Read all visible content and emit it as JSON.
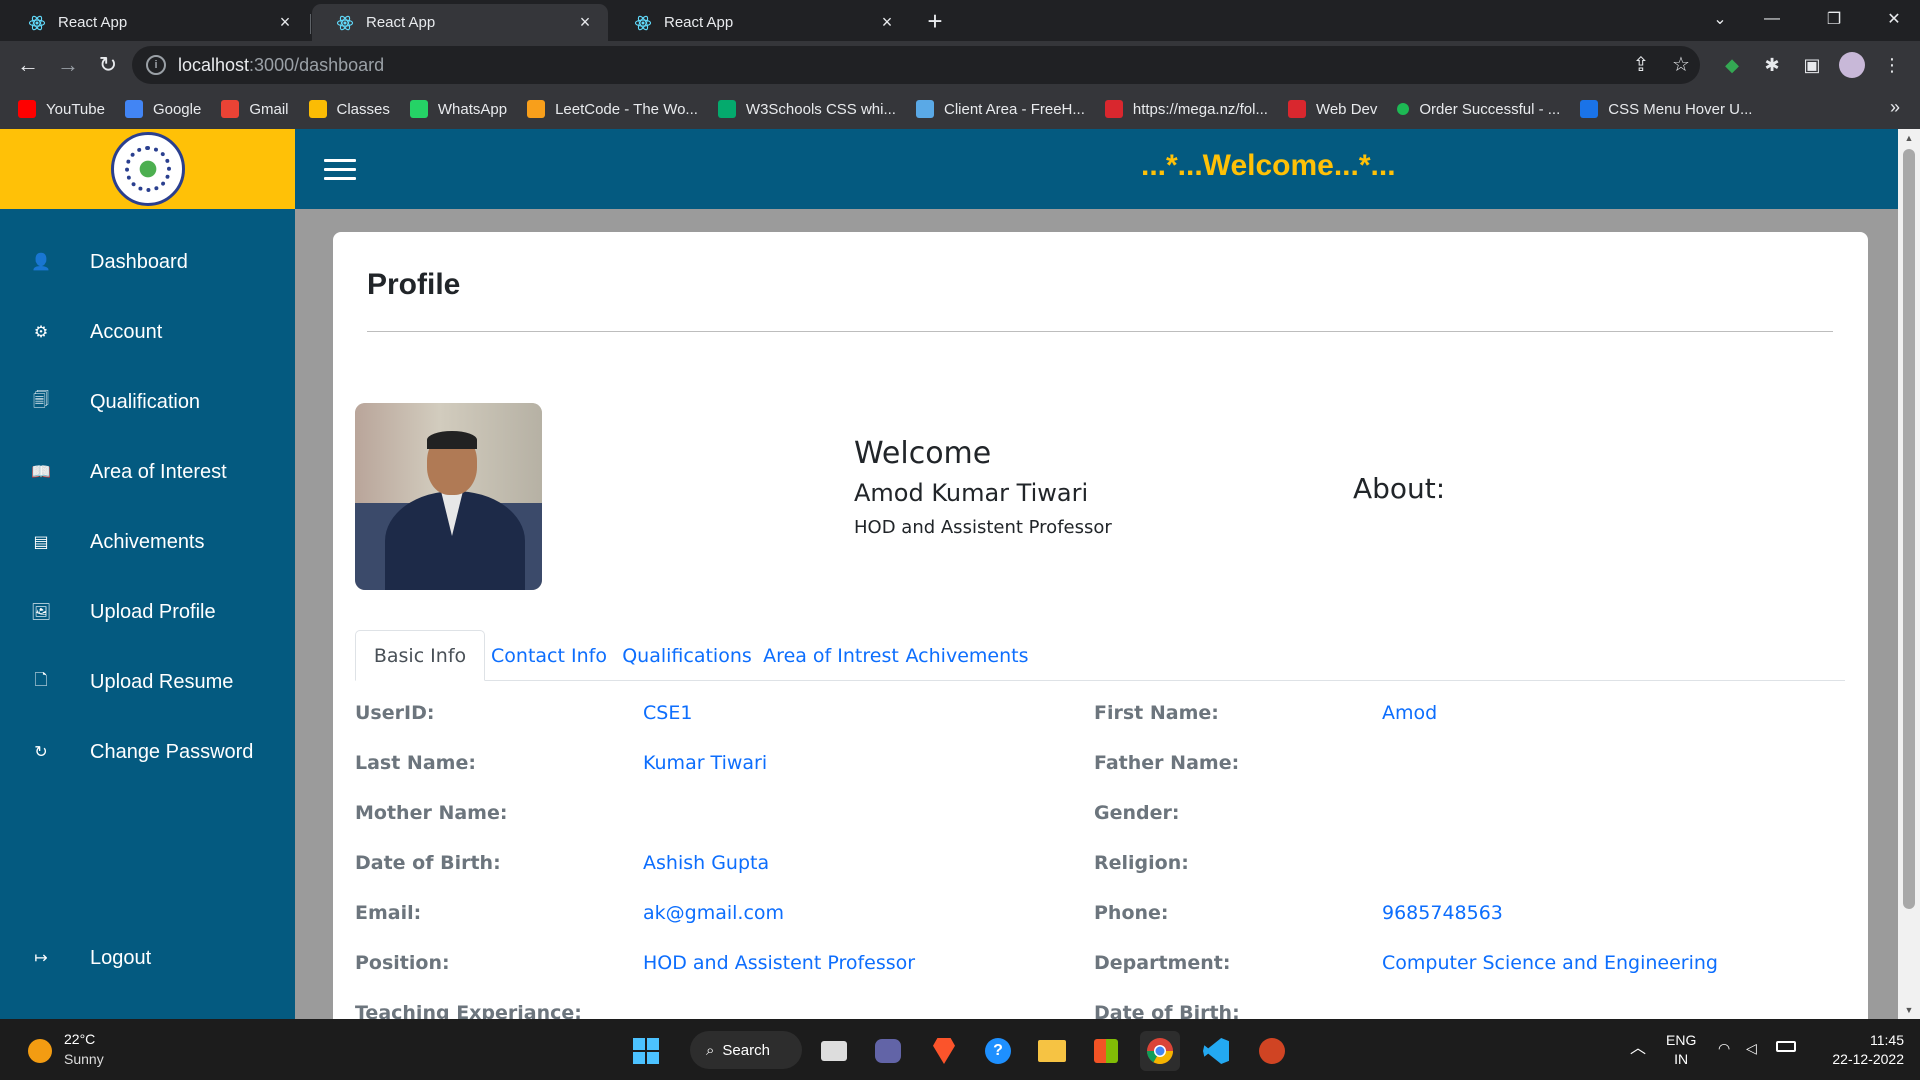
{
  "browser": {
    "tabs": [
      {
        "title": "React App"
      },
      {
        "title": "React App"
      },
      {
        "title": "React App"
      }
    ],
    "url_host": "localhost",
    "url_path": ":3000/dashboard",
    "bookmarks": [
      {
        "label": "YouTube",
        "icon": "youtube-icon",
        "color": "#ff0000"
      },
      {
        "label": "Google",
        "icon": "google-icon",
        "color": "#4285f4"
      },
      {
        "label": "Gmail",
        "icon": "gmail-icon",
        "color": "#ea4335"
      },
      {
        "label": "Classes",
        "icon": "classroom-icon",
        "color": "#fbbc04"
      },
      {
        "label": "WhatsApp",
        "icon": "whatsapp-icon",
        "color": "#25d366"
      },
      {
        "label": "LeetCode - The Wo...",
        "icon": "leetcode-icon",
        "color": "#f89f1b"
      },
      {
        "label": "W3Schools CSS whi...",
        "icon": "w3schools-icon",
        "color": "#04aa6d"
      },
      {
        "label": "Client Area - FreeH...",
        "icon": "freehosting-icon",
        "color": "#5aa9e6"
      },
      {
        "label": "https://mega.nz/fol...",
        "icon": "mega-icon",
        "color": "#d9272e"
      },
      {
        "label": "Web Dev",
        "icon": "mega-icon",
        "color": "#d9272e"
      },
      {
        "label": "Order Successful - ...",
        "icon": "dot-icon",
        "color": "#1db954"
      },
      {
        "label": "CSS Menu Hover U...",
        "icon": "bookmark-site-icon",
        "color": "#1a73e8"
      }
    ]
  },
  "app": {
    "banner": "...*...Welcome...*...",
    "accent": "#ffc107",
    "brand": "#045a80",
    "sidebar": [
      {
        "label": "Dashboard",
        "icon": "user-icon",
        "glyph": "👤"
      },
      {
        "label": "Account",
        "icon": "gear-icon",
        "glyph": "⚙"
      },
      {
        "label": "Qualification",
        "icon": "document-icon",
        "glyph": "🗐"
      },
      {
        "label": "Area of Interest",
        "icon": "book-icon",
        "glyph": "📖"
      },
      {
        "label": "Achivements",
        "icon": "list-icon",
        "glyph": "▤"
      },
      {
        "label": "Upload Profile",
        "icon": "image-icon",
        "glyph": "🖼"
      },
      {
        "label": "Upload Resume",
        "icon": "file-upload-icon",
        "glyph": "🗋"
      },
      {
        "label": "Change Password",
        "icon": "refresh-icon",
        "glyph": "↻"
      }
    ],
    "logout": {
      "label": "Logout",
      "icon": "logout-icon",
      "glyph": "↦"
    },
    "profile": {
      "title": "Profile",
      "welcome": "Welcome",
      "name": "Amod Kumar Tiwari",
      "position": "HOD and Assistent Professor",
      "about": "About:"
    },
    "tabs": [
      {
        "label": "Basic Info",
        "active": true
      },
      {
        "label": "Contact Info",
        "active": false
      },
      {
        "label": "Qualifications",
        "active": false
      },
      {
        "label": "Area of Intrest",
        "active": false
      },
      {
        "label": "Achivements",
        "active": false
      }
    ],
    "basic_info": [
      {
        "left_label": "UserID:",
        "left_value": "CSE1",
        "right_label": "First Name:",
        "right_value": "Amod"
      },
      {
        "left_label": "Last Name:",
        "left_value": "Kumar Tiwari",
        "right_label": "Father Name:",
        "right_value": ""
      },
      {
        "left_label": "Mother Name:",
        "left_value": "",
        "right_label": "Gender:",
        "right_value": ""
      },
      {
        "left_label": "Date of Birth:",
        "left_value": "Ashish Gupta",
        "right_label": "Religion:",
        "right_value": ""
      },
      {
        "left_label": "Email:",
        "left_value": "ak@gmail.com",
        "right_label": "Phone:",
        "right_value": "9685748563"
      },
      {
        "left_label": "Position:",
        "left_value": "HOD and Assistent Professor",
        "right_label": "Department:",
        "right_value": "Computer Science and Engineering"
      },
      {
        "left_label": "Teaching Experiance:",
        "left_value": "",
        "right_label": "Date of Birth:",
        "right_value": ""
      }
    ]
  },
  "taskbar": {
    "weather_temp": "22°C",
    "weather_desc": "Sunny",
    "search_label": "Search",
    "lang": "ENG",
    "region": "IN",
    "time": "11:45",
    "date": "22-12-2022"
  }
}
